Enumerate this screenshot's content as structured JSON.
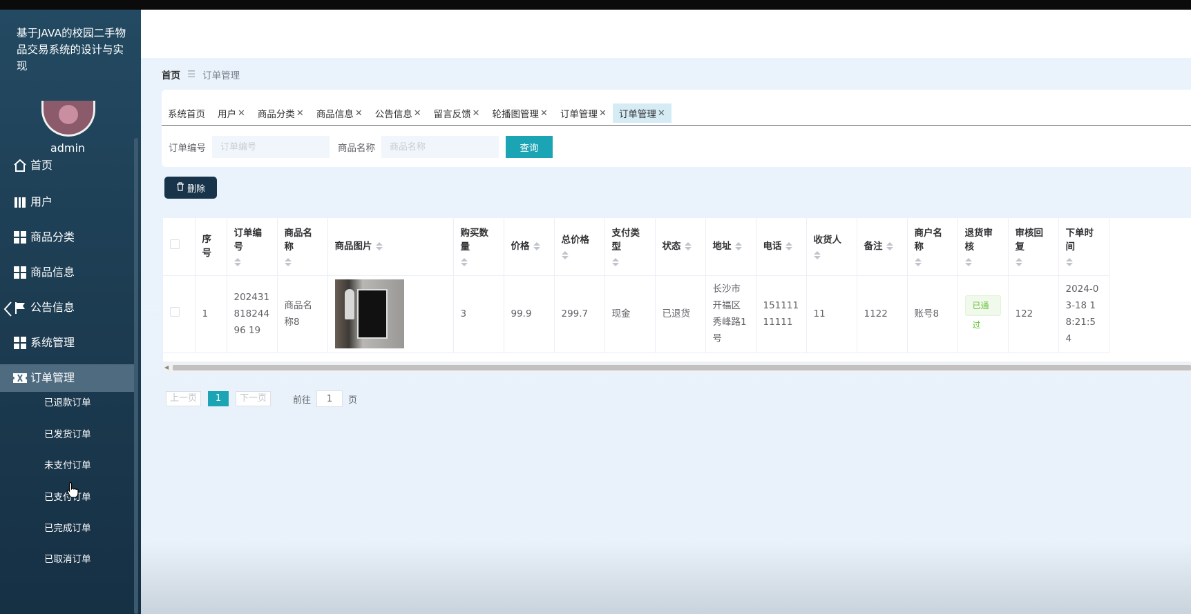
{
  "app_title": "基于JAVA的校园二手物品交易系统的设计与实现",
  "user": {
    "name": "admin"
  },
  "nav": [
    {
      "label": "首页",
      "icon": "home-icon"
    },
    {
      "label": "用户",
      "icon": "user-book-icon"
    },
    {
      "label": "商品分类",
      "icon": "grid-icon"
    },
    {
      "label": "商品信息",
      "icon": "grid-icon"
    },
    {
      "label": "公告信息",
      "icon": "flag-icon"
    },
    {
      "label": "系统管理",
      "icon": "grid-icon"
    },
    {
      "label": "订单管理",
      "icon": "ticket-icon",
      "active": true
    }
  ],
  "subnav": [
    "已退款订单",
    "已发货订单",
    "未支付订单",
    "已支付订单",
    "已完成订单",
    "已取消订单"
  ],
  "breadcrumb": {
    "home": "首页",
    "separator": "☰",
    "current": "订单管理"
  },
  "tabs": [
    {
      "label": "系统首页",
      "closable": false
    },
    {
      "label": "用户",
      "closable": true
    },
    {
      "label": "商品分类",
      "closable": true
    },
    {
      "label": "商品信息",
      "closable": true
    },
    {
      "label": "公告信息",
      "closable": true
    },
    {
      "label": "留言反馈",
      "closable": true
    },
    {
      "label": "轮播图管理",
      "closable": true
    },
    {
      "label": "订单管理",
      "closable": true
    },
    {
      "label": "订单管理",
      "closable": true,
      "active": true
    }
  ],
  "search": {
    "order_no_label": "订单编号",
    "order_no_placeholder": "订单编号",
    "product_label": "商品名称",
    "product_placeholder": "商品名称",
    "query_button": "查询"
  },
  "actions": {
    "delete_button": "删除"
  },
  "table": {
    "columns": [
      "序号",
      "订单编号",
      "商品名称",
      "商品图片",
      "购买数量",
      "价格",
      "总价格",
      "支付类型",
      "状态",
      "地址",
      "电话",
      "收货人",
      "备注",
      "商户名称",
      "退货审核",
      "审核回复",
      "下单时间"
    ],
    "rows": [
      {
        "index": "1",
        "order_no": "20243181824496 19",
        "product_name": "商品名称8",
        "image": "product-thumbnail",
        "quantity": "3",
        "price": "99.9",
        "total": "299.7",
        "pay_type": "现金",
        "status": "已退货",
        "address": "长沙市开福区秀峰路1号",
        "phone": "15111111111",
        "receiver": "11",
        "remark": "1122",
        "merchant": "账号8",
        "return_review": "已通过",
        "review_reply": "122",
        "order_time": "2024-03-18 18:21:54"
      }
    ]
  },
  "pagination": {
    "prev": "上一页",
    "current": "1",
    "next": "下一页",
    "goto_label": "前往",
    "goto_value": "1",
    "page_unit": "页"
  },
  "colors": {
    "sidebar": "#1d3d53",
    "accent": "#1aa4b4",
    "delete_btn": "#17344a",
    "content_bg": "#eaf3fb"
  }
}
